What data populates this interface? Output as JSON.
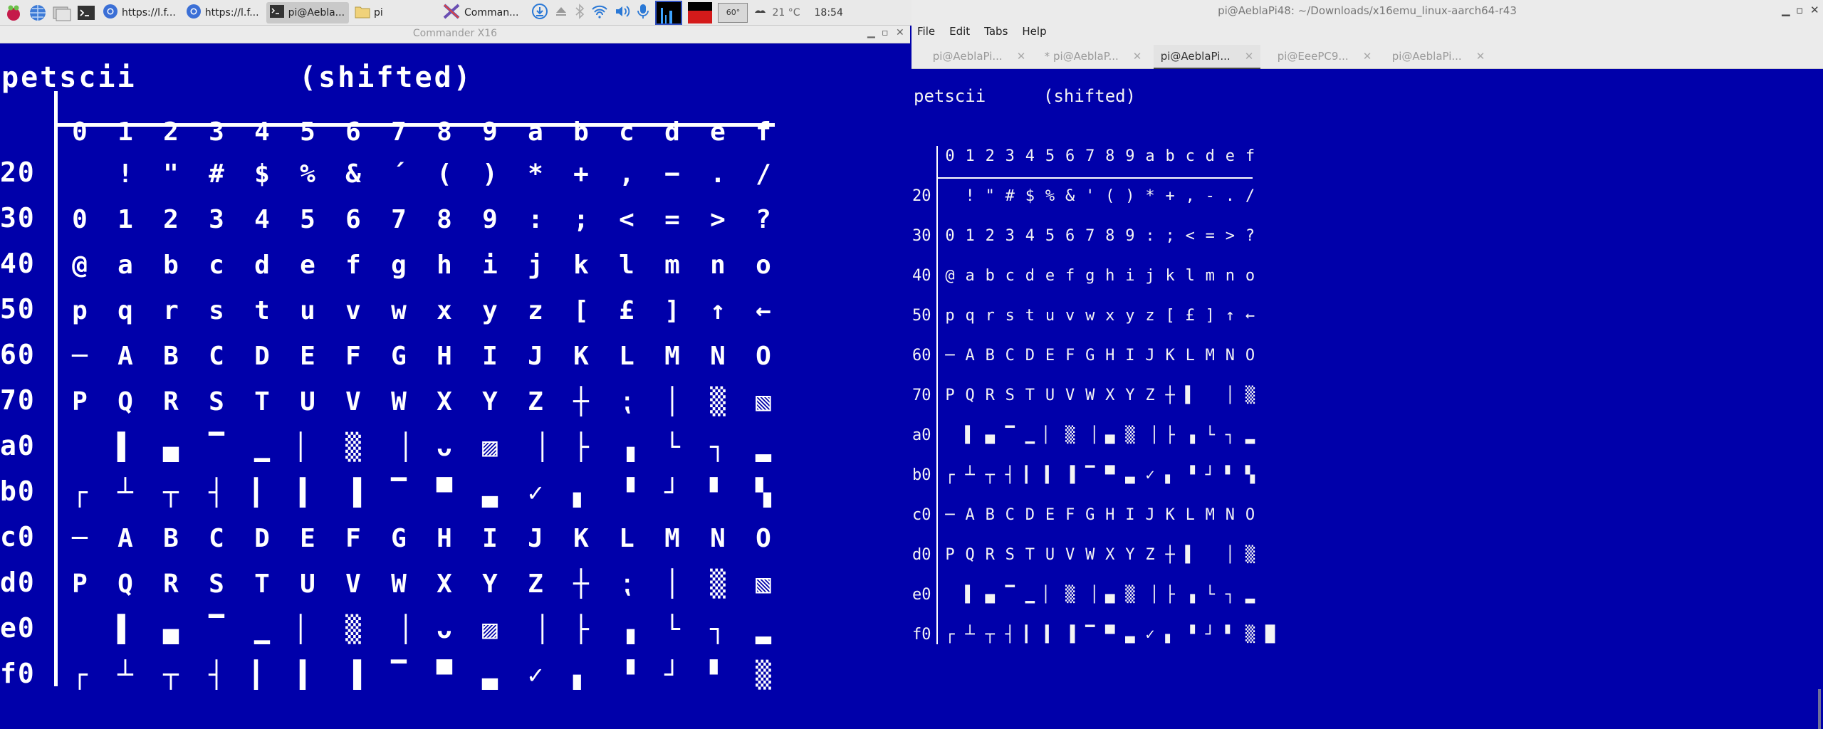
{
  "taskbar": {
    "buttons": [
      {
        "label": "https://l.f...",
        "icon": "chromium-icon"
      },
      {
        "label": "https://l.f...",
        "icon": "chromium-icon"
      },
      {
        "label": "pi@Aebla...",
        "icon": "terminal-icon"
      },
      {
        "label": "pi",
        "icon": "folder-icon"
      },
      {
        "label": "Comman...",
        "icon": "commander-x16-icon"
      }
    ],
    "temp_widget": "60°",
    "weather": "21 °C",
    "clock": "18:54"
  },
  "emulator": {
    "title": "Commander X16",
    "header_left": "petscii",
    "header_right": "(shifted)",
    "columns": [
      "0",
      "1",
      "2",
      "3",
      "4",
      "5",
      "6",
      "7",
      "8",
      "9",
      "a",
      "b",
      "c",
      "d",
      "e",
      "f"
    ],
    "rows": [
      {
        "label": "20",
        "cells": [
          " ",
          "!",
          "\"",
          "#",
          "$",
          "%",
          "&",
          "´",
          "(",
          ")",
          "*",
          "+",
          ",",
          "−",
          ".",
          "/"
        ]
      },
      {
        "label": "30",
        "cells": [
          "0",
          "1",
          "2",
          "3",
          "4",
          "5",
          "6",
          "7",
          "8",
          "9",
          ":",
          ";",
          "<",
          "=",
          ">",
          "?"
        ]
      },
      {
        "label": "40",
        "cells": [
          "@",
          "a",
          "b",
          "c",
          "d",
          "e",
          "f",
          "g",
          "h",
          "i",
          "j",
          "k",
          "l",
          "m",
          "n",
          "o"
        ]
      },
      {
        "label": "50",
        "cells": [
          "p",
          "q",
          "r",
          "s",
          "t",
          "u",
          "v",
          "w",
          "x",
          "y",
          "z",
          "[",
          "£",
          "]",
          "↑",
          "←"
        ]
      },
      {
        "label": "60",
        "cells": [
          "─",
          "A",
          "B",
          "C",
          "D",
          "E",
          "F",
          "G",
          "H",
          "I",
          "J",
          "K",
          "L",
          "M",
          "N",
          "O"
        ]
      },
      {
        "label": "70",
        "cells": [
          "P",
          "Q",
          "R",
          "S",
          "T",
          "U",
          "V",
          "W",
          "X",
          "Y",
          "Z",
          "┼",
          "⁏",
          "│",
          "▒",
          "▧"
        ]
      },
      {
        "label": "a0",
        "cells": [
          " ",
          "▌",
          "▄",
          "▔",
          "▁",
          "▏",
          "▒",
          "▕",
          "ᴗ",
          "▨",
          "▕",
          "├",
          "▗",
          "└",
          "┐",
          "▂"
        ]
      },
      {
        "label": "b0",
        "cells": [
          "┌",
          "┴",
          "┬",
          "┤",
          "▎",
          "▍",
          "▐",
          "▔",
          "▀",
          "▃",
          "✓",
          "▖",
          "▝",
          "┘",
          "▘",
          "▚"
        ]
      },
      {
        "label": "c0",
        "cells": [
          "─",
          "A",
          "B",
          "C",
          "D",
          "E",
          "F",
          "G",
          "H",
          "I",
          "J",
          "K",
          "L",
          "M",
          "N",
          "O"
        ]
      },
      {
        "label": "d0",
        "cells": [
          "P",
          "Q",
          "R",
          "S",
          "T",
          "U",
          "V",
          "W",
          "X",
          "Y",
          "Z",
          "┼",
          "⁏",
          "│",
          "▒",
          "▧"
        ]
      },
      {
        "label": "e0",
        "cells": [
          " ",
          "▌",
          "▄",
          "▔",
          "▁",
          "▏",
          "▒",
          "▕",
          "ᴗ",
          "▨",
          "▕",
          "├",
          "▗",
          "└",
          "┐",
          "▂"
        ]
      },
      {
        "label": "f0",
        "cells": [
          "┌",
          "┴",
          "┬",
          "┤",
          "▎",
          "▍",
          "▐",
          "▔",
          "▀",
          "▃",
          "✓",
          "▖",
          "▝",
          "┘",
          "▘",
          "▒"
        ]
      }
    ]
  },
  "terminal": {
    "title": "pi@AeblaPi48: ~/Downloads/x16emu_linux-aarch64-r43",
    "menu": [
      "File",
      "Edit",
      "Tabs",
      "Help"
    ],
    "tabs": [
      {
        "label": "pi@AeblaPi...",
        "active": false
      },
      {
        "label": "* pi@AeblaP...",
        "active": false
      },
      {
        "label": "pi@AeblaPi...",
        "active": true
      },
      {
        "label": "pi@EeePC9...",
        "active": false
      },
      {
        "label": "pi@AeblaPi...",
        "active": false
      }
    ],
    "header_left": "petscii",
    "header_right": "(shifted)",
    "columns": [
      "0",
      "1",
      "2",
      "3",
      "4",
      "5",
      "6",
      "7",
      "8",
      "9",
      "a",
      "b",
      "c",
      "d",
      "e",
      "f"
    ],
    "rows": [
      {
        "label": "20",
        "cells": [
          " ",
          "!",
          "\"",
          "#",
          "$",
          "%",
          "&",
          "'",
          "(",
          ")",
          "*",
          "+",
          ",",
          "-",
          ".",
          "/"
        ]
      },
      {
        "label": "30",
        "cells": [
          "0",
          "1",
          "2",
          "3",
          "4",
          "5",
          "6",
          "7",
          "8",
          "9",
          ":",
          ";",
          "<",
          "=",
          ">",
          "?"
        ]
      },
      {
        "label": "40",
        "cells": [
          "@",
          "a",
          "b",
          "c",
          "d",
          "e",
          "f",
          "g",
          "h",
          "i",
          "j",
          "k",
          "l",
          "m",
          "n",
          "o"
        ]
      },
      {
        "label": "50",
        "cells": [
          "p",
          "q",
          "r",
          "s",
          "t",
          "u",
          "v",
          "w",
          "x",
          "y",
          "z",
          "[",
          "£",
          "]",
          "↑",
          "←"
        ]
      },
      {
        "label": "60",
        "cells": [
          "─",
          "A",
          "B",
          "C",
          "D",
          "E",
          "F",
          "G",
          "H",
          "I",
          "J",
          "K",
          "L",
          "M",
          "N",
          "O"
        ]
      },
      {
        "label": "70",
        "cells": [
          "P",
          "Q",
          "R",
          "S",
          "T",
          "U",
          "V",
          "W",
          "X",
          "Y",
          "Z",
          "┼",
          "▌",
          " ",
          "│",
          "▒"
        ]
      },
      {
        "label": "a0",
        "cells": [
          " ",
          "▌",
          "▄",
          "▔",
          "▁",
          "▏",
          "▒",
          "▕",
          "▄",
          "▒",
          "▕",
          "├",
          "▗",
          "└",
          "┐",
          "▂"
        ]
      },
      {
        "label": "b0",
        "cells": [
          "┌",
          "┴",
          "┬",
          "┤",
          "▎",
          "▍",
          "▐",
          "▔",
          "▀",
          "▃",
          "✓",
          "▖",
          "▝",
          "┘",
          "▘",
          "▚"
        ]
      },
      {
        "label": "c0",
        "cells": [
          "─",
          "A",
          "B",
          "C",
          "D",
          "E",
          "F",
          "G",
          "H",
          "I",
          "J",
          "K",
          "L",
          "M",
          "N",
          "O"
        ]
      },
      {
        "label": "d0",
        "cells": [
          "P",
          "Q",
          "R",
          "S",
          "T",
          "U",
          "V",
          "W",
          "X",
          "Y",
          "Z",
          "┼",
          "▌",
          " ",
          "│",
          "▒"
        ]
      },
      {
        "label": "e0",
        "cells": [
          " ",
          "▌",
          "▄",
          "▔",
          "▁",
          "▏",
          "▒",
          "▕",
          "▄",
          "▒",
          "▕",
          "├",
          "▗",
          "└",
          "┐",
          "▂"
        ]
      },
      {
        "label": "f0",
        "cells": [
          "┌",
          "┴",
          "┬",
          "┤",
          "▎",
          "▍",
          "▐",
          "▔",
          "▀",
          "▃",
          "✓",
          "▖",
          "▝",
          "┘",
          "▘",
          "▒",
          "█"
        ]
      }
    ]
  }
}
